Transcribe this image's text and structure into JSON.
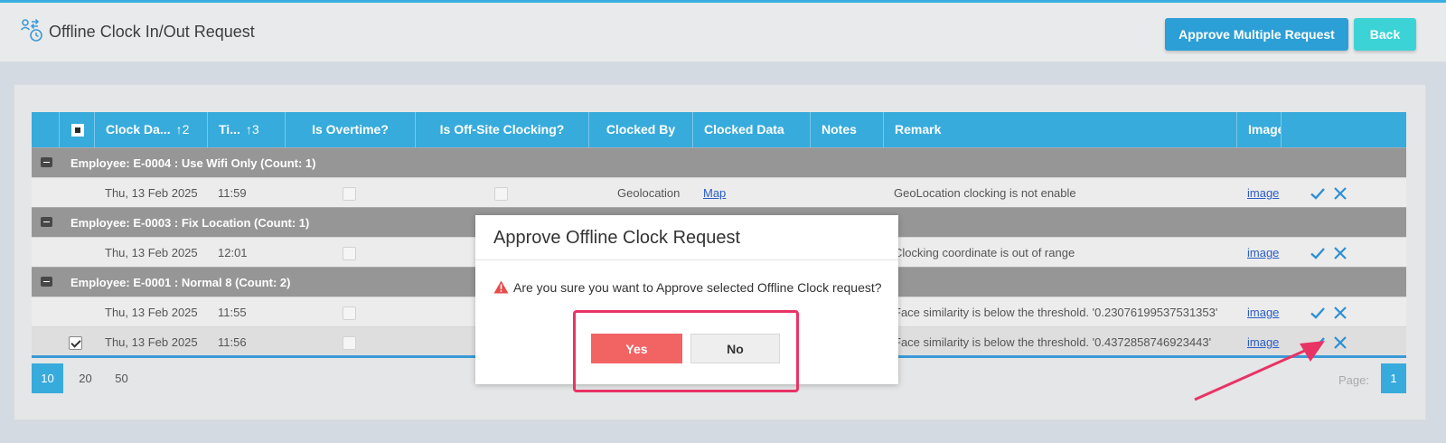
{
  "header": {
    "title": "Offline Clock In/Out Request",
    "approve_multiple_label": "Approve Multiple Request",
    "back_label": "Back"
  },
  "table": {
    "columns": {
      "clock_date": "Clock Da...",
      "clock_date_sort": "2",
      "time": "Ti...",
      "time_sort": "3",
      "is_overtime": "Is Overtime?",
      "is_offsite": "Is Off-Site Clocking?",
      "clocked_by": "Clocked By",
      "clocked_data": "Clocked Data",
      "notes": "Notes",
      "remark": "Remark",
      "image": "Image"
    },
    "groups": [
      {
        "label": "Employee: E-0004 : Use Wifi Only (Count: 1)",
        "rows": [
          {
            "date": "Thu, 13 Feb 2025",
            "time": "11:59",
            "clocked_by": "Geolocation",
            "clocked_data": "Map",
            "remark": "GeoLocation clocking is not enable",
            "image": "image"
          }
        ]
      },
      {
        "label": "Employee: E-0003 : Fix Location (Count: 1)",
        "rows": [
          {
            "date": "Thu, 13 Feb 2025",
            "time": "12:01",
            "remark": "Clocking coordinate is out of range",
            "image": "image"
          }
        ]
      },
      {
        "label": "Employee: E-0001 : Normal 8 (Count: 2)",
        "rows": [
          {
            "date": "Thu, 13 Feb 2025",
            "time": "11:55",
            "remark": "Face similarity is below the threshold. '0.23076199537531353'",
            "image": "image"
          },
          {
            "date": "Thu, 13 Feb 2025",
            "time": "11:56",
            "remark": "Face similarity is below the threshold. '0.4372858746923443'",
            "image": "image",
            "selected": true
          }
        ]
      }
    ]
  },
  "pagination": {
    "sizes": [
      "10",
      "20",
      "50"
    ],
    "active_size": "10",
    "page_label": "Page:",
    "current_page": "1"
  },
  "dialog": {
    "title": "Approve Offline Clock Request",
    "message": "Are you sure you want to Approve selected Offline Clock request?",
    "yes_label": "Yes",
    "no_label": "No"
  },
  "colors": {
    "accent": "#37abdc",
    "yes": "#f26464",
    "annotation": "#e83365"
  }
}
